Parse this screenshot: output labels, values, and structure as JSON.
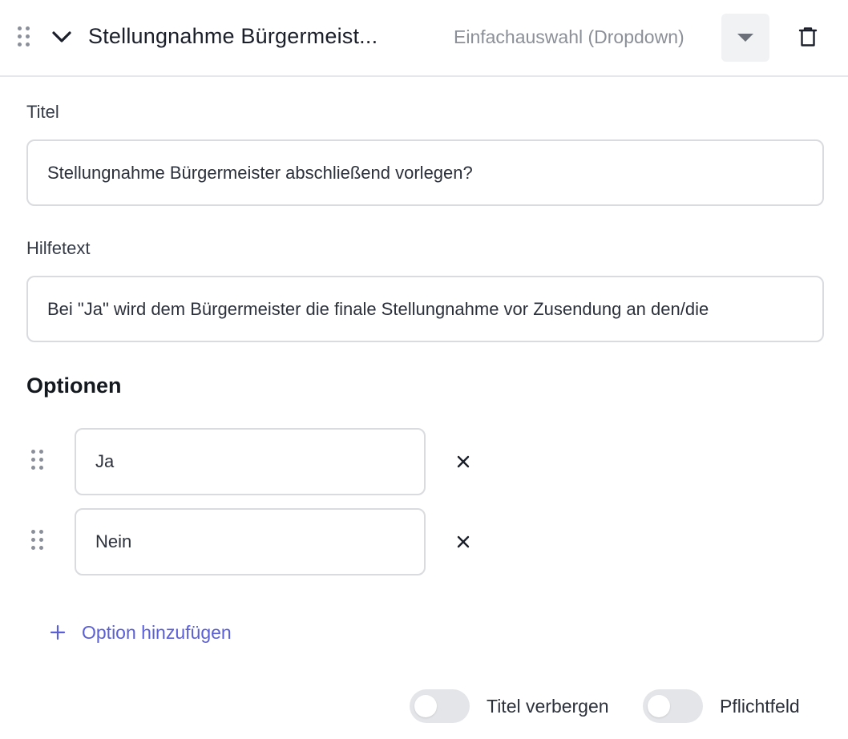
{
  "header": {
    "title": "Stellungnahme Bürgermeist...",
    "field_type": "Einfachauswahl (Dropdown)"
  },
  "form": {
    "title_label": "Titel",
    "title_value": "Stellungnahme Bürgermeister abschließend vorlegen?",
    "help_label": "Hilfetext",
    "help_value": "Bei \"Ja\" wird dem Bürgermeister die finale Stellungnahme vor Zusendung an den/die"
  },
  "options": {
    "heading": "Optionen",
    "items": [
      {
        "value": "Ja"
      },
      {
        "value": "Nein"
      }
    ],
    "add_label": "Option hinzufügen"
  },
  "footer": {
    "hide_title_label": "Titel verbergen",
    "hide_title_on": false,
    "required_label": "Pflichtfeld",
    "required_on": false
  },
  "colors": {
    "accent": "#5b5fd6",
    "border": "#d9dbdf",
    "toggle_off": "#e4e5e8"
  },
  "icons": [
    "drag-handle-icon",
    "chevron-down-icon",
    "caret-down-icon",
    "trash-icon",
    "close-icon",
    "plus-icon"
  ]
}
